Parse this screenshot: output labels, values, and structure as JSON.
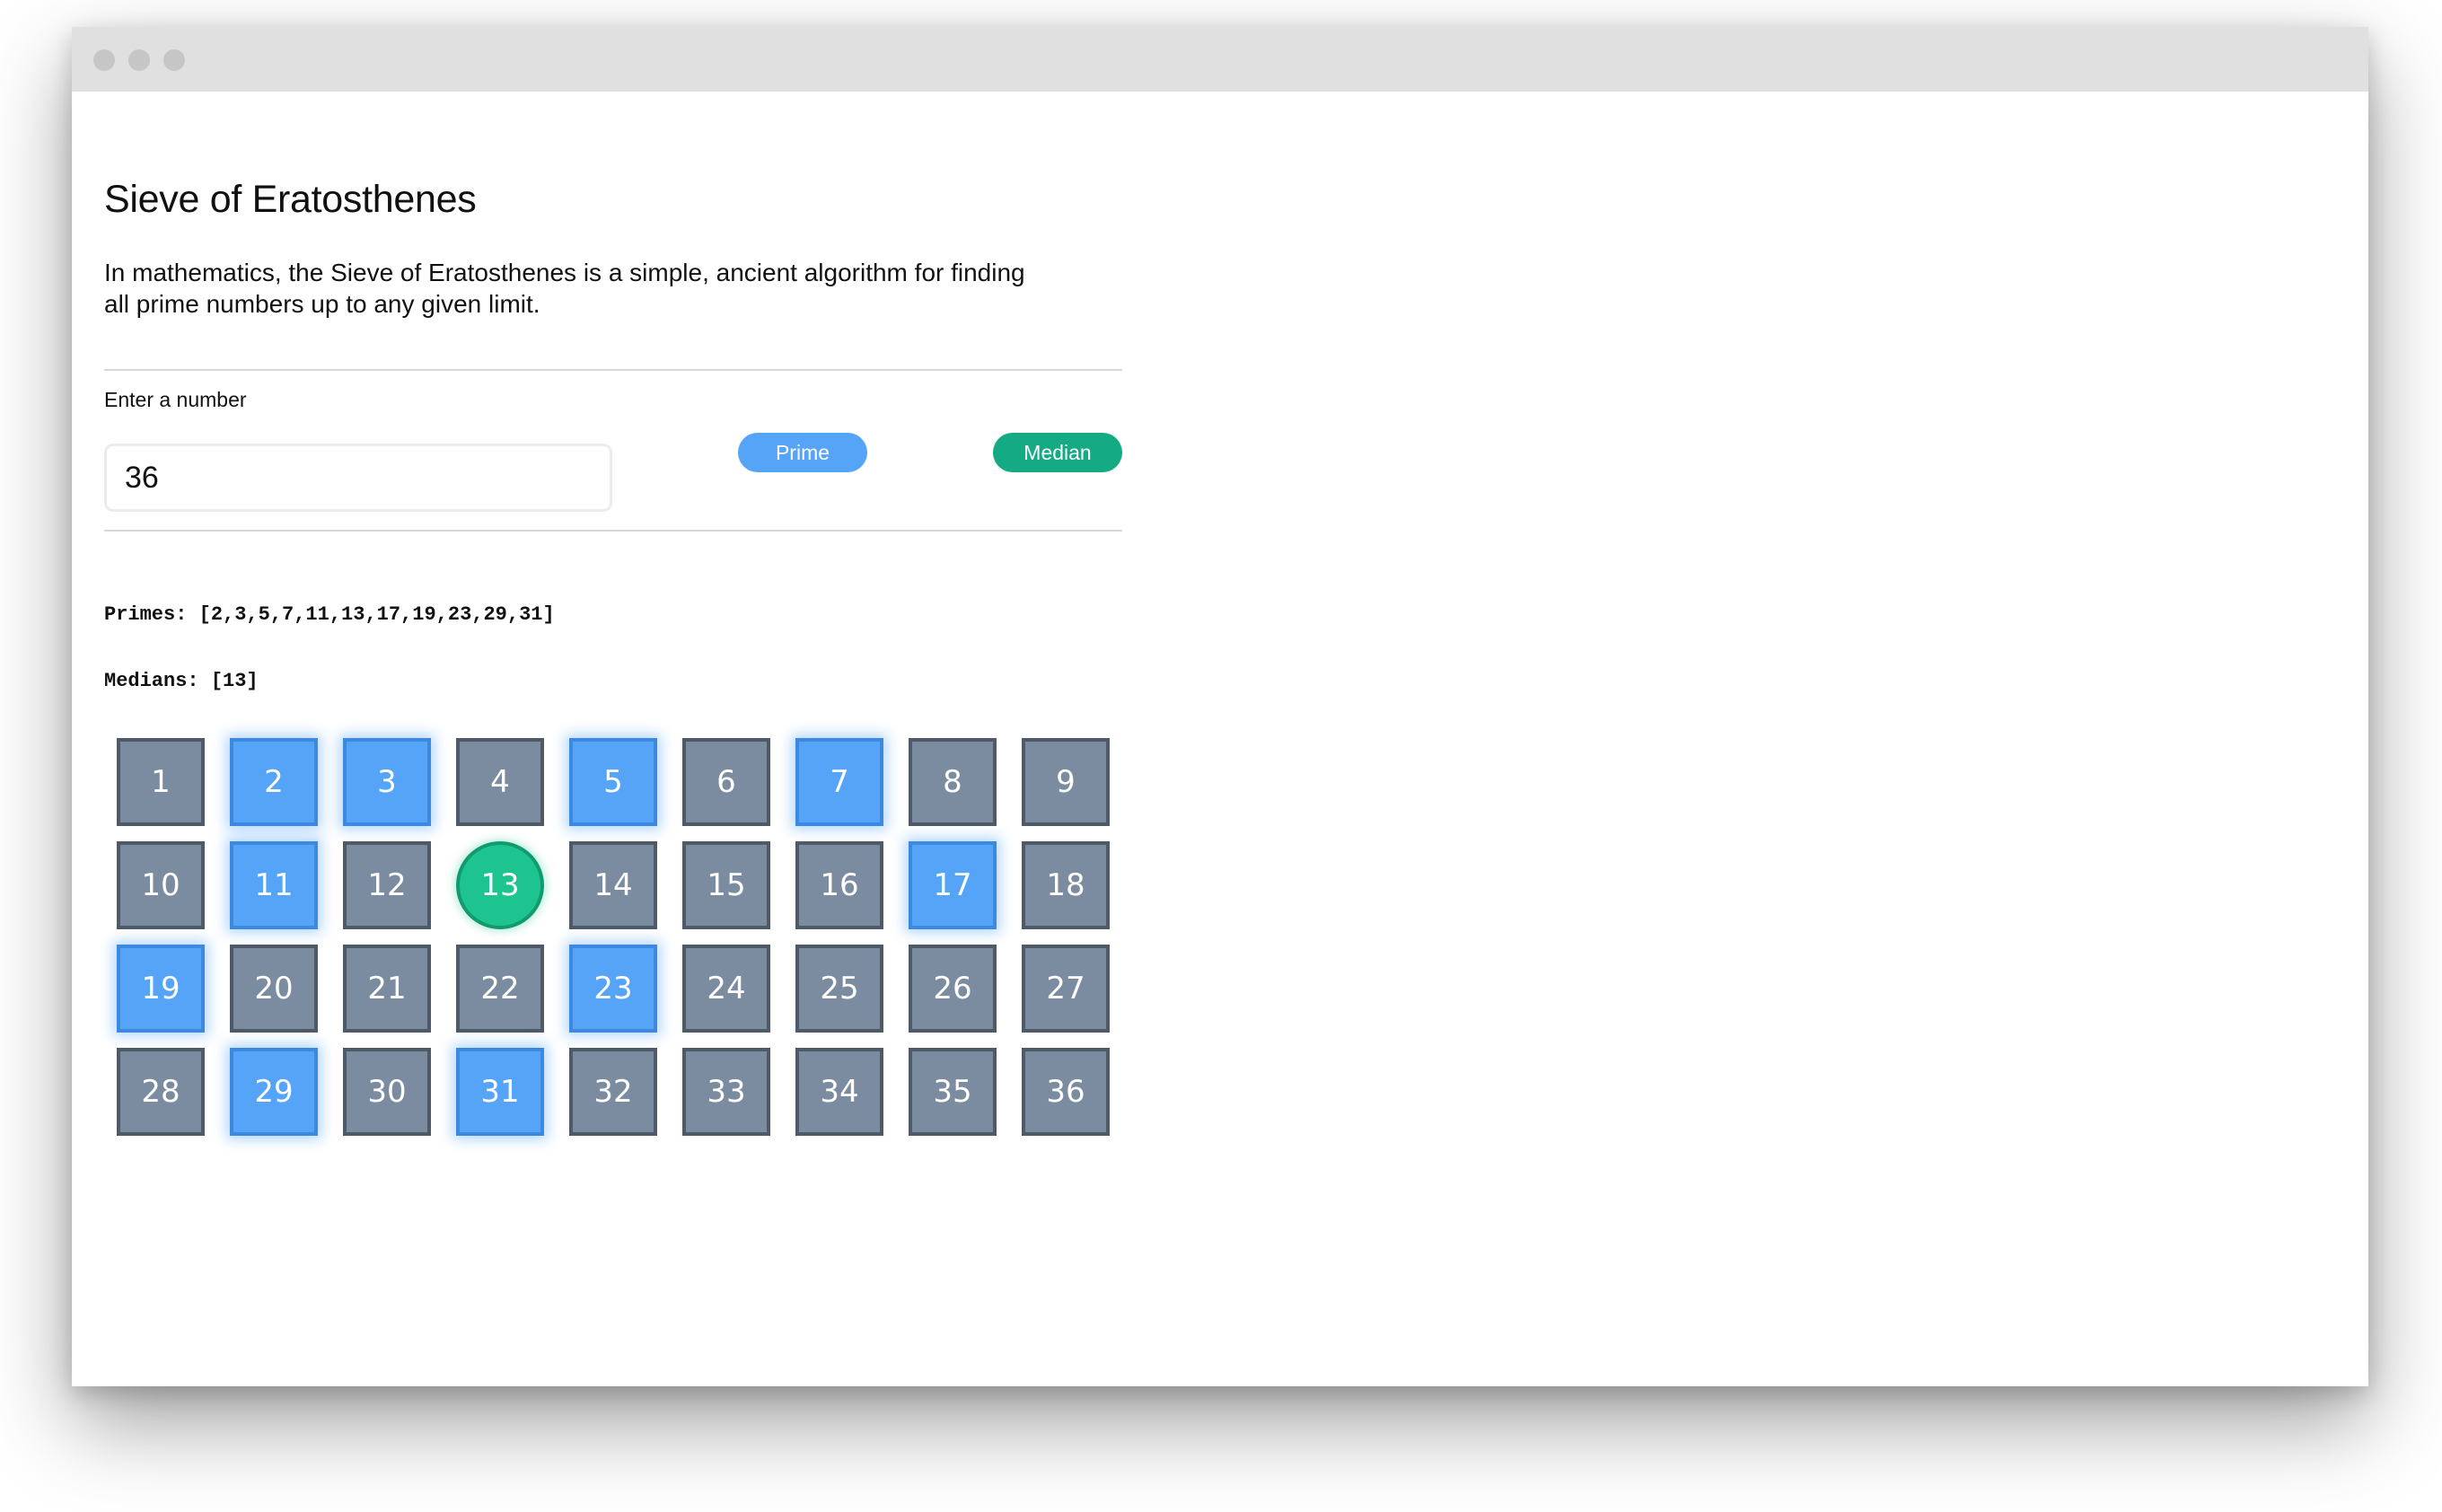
{
  "window": {
    "controls": [
      "close-dot",
      "minimize-dot",
      "maximize-dot"
    ]
  },
  "page": {
    "title": "Sieve of Eratosthenes",
    "description": "In mathematics, the Sieve of Eratosthenes is a simple, ancient algorithm for finding all prime numbers up to any given limit."
  },
  "form": {
    "label": "Enter a number",
    "value": "36",
    "prime_button": "Prime",
    "median_button": "Median"
  },
  "results": {
    "primes_text": "Primes: [2,3,5,7,11,13,17,19,23,29,31]",
    "medians_text": "Medians: [13]"
  },
  "grid": {
    "numbers": [
      1,
      2,
      3,
      4,
      5,
      6,
      7,
      8,
      9,
      10,
      11,
      12,
      13,
      14,
      15,
      16,
      17,
      18,
      19,
      20,
      21,
      22,
      23,
      24,
      25,
      26,
      27,
      28,
      29,
      30,
      31,
      32,
      33,
      34,
      35,
      36
    ],
    "primes": [
      2,
      3,
      5,
      7,
      11,
      17,
      19,
      23,
      29,
      31
    ],
    "medians": [
      13
    ],
    "columns": 9
  },
  "colors": {
    "prime": "#55a4f8",
    "median": "#1ec48f",
    "composite": "#7c8ca0"
  }
}
